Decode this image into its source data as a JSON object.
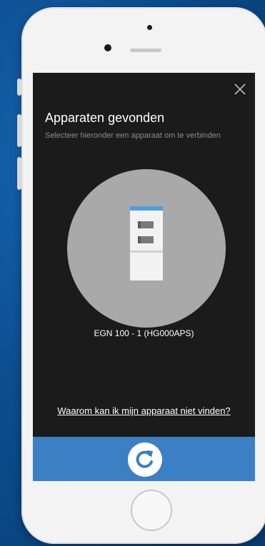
{
  "modal": {
    "title": "Apparaten gevonden",
    "subtitle": "Selecteer hieronder een apparaat om te verbinden",
    "close_icon": "close-icon"
  },
  "device": {
    "name": "EGN 100 - 1 (HG000APS)",
    "icon": "panel-device-icon"
  },
  "help_link": "Waarom kan ik mijn apparaat niet vinden?",
  "bottom_bar": {
    "refresh_icon": "refresh-icon"
  },
  "colors": {
    "background": "#0b4d8f",
    "screen": "#1b1b1b",
    "accent": "#3b7fc4",
    "device_circle": "#a9a9a9"
  }
}
